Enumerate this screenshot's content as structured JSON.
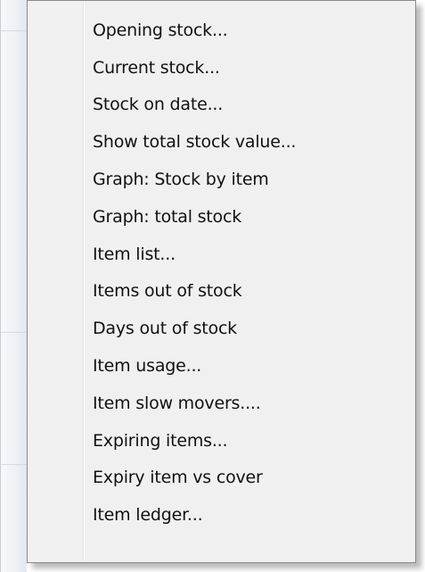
{
  "menu": {
    "items": [
      {
        "label": "Opening stock..."
      },
      {
        "label": "Current stock..."
      },
      {
        "label": "Stock on date..."
      },
      {
        "label": "Show total stock value..."
      },
      {
        "label": "Graph: Stock by item"
      },
      {
        "label": "Graph: total stock"
      },
      {
        "label": "Item list..."
      },
      {
        "label": "Items out of stock"
      },
      {
        "label": "Days out of stock"
      },
      {
        "label": "Item usage..."
      },
      {
        "label": "Item slow movers...."
      },
      {
        "label": "Expiring items..."
      },
      {
        "label": "Expiry item vs cover"
      },
      {
        "label": "Item ledger..."
      }
    ]
  },
  "colors": {
    "menu_background": "#f0f0f0",
    "menu_border": "#8a8a8a",
    "text": "#111111",
    "hover_highlight": "#e5eef9"
  }
}
